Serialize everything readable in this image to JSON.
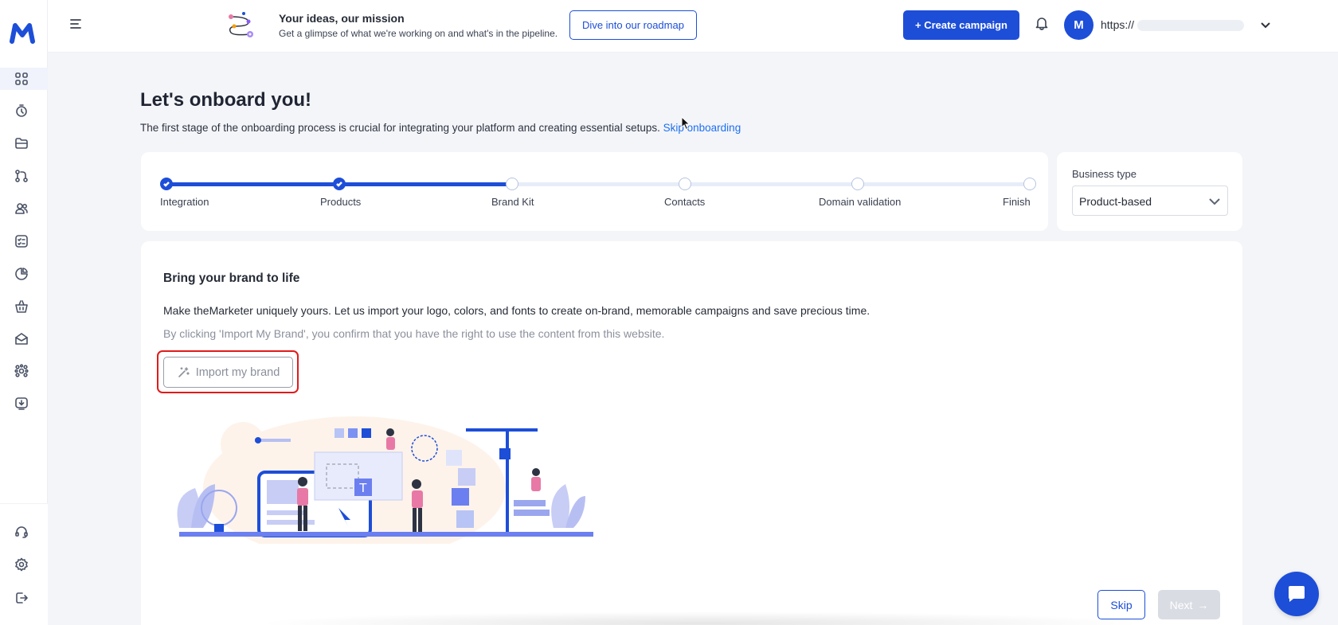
{
  "header": {
    "promo_title": "Your ideas, our mission",
    "promo_subtitle": "Get a glimpse of what we're working on and what's in the pipeline.",
    "roadmap_button": "Dive into our roadmap",
    "create_button": "+ Create campaign",
    "avatar_letter": "M",
    "account_url": "https://"
  },
  "sidebar": {
    "icons": [
      "dashboard-icon",
      "automation-timer-icon",
      "folder-icon",
      "workflow-icon",
      "audience-icon",
      "checklist-icon",
      "reports-icon",
      "products-basket-icon",
      "email-icon",
      "integrations-icon",
      "download-icon"
    ],
    "bottom_icons": [
      "support-headset-icon",
      "settings-icon",
      "logout-icon"
    ]
  },
  "page": {
    "title": "Let's onboard you!",
    "subtitle": "The first stage of the onboarding process is crucial for integrating your platform and creating essential setups.",
    "skip_link": "Skip onboarding"
  },
  "stepper": {
    "steps": [
      {
        "label": "Integration",
        "state": "done"
      },
      {
        "label": "Products",
        "state": "done"
      },
      {
        "label": "Brand Kit",
        "state": "current"
      },
      {
        "label": "Contacts",
        "state": "pending"
      },
      {
        "label": "Domain validation",
        "state": "pending"
      },
      {
        "label": "Finish",
        "state": "pending"
      }
    ]
  },
  "business_type": {
    "label": "Business type",
    "value": "Product-based"
  },
  "brand": {
    "title": "Bring your brand to life",
    "description": "Make theMarketer uniquely yours. Let us import your logo, colors, and fonts to create on-brand, memorable campaigns and save precious time.",
    "note": "By clicking 'Import My Brand', you confirm that you have the right to use the content from this website.",
    "import_button": "Import my brand"
  },
  "footer_buttons": {
    "skip": "Skip",
    "next": "Next"
  },
  "colors": {
    "primary": "#1d4ed8",
    "highlight": "#e11b1b",
    "link": "#1d6ff2"
  }
}
